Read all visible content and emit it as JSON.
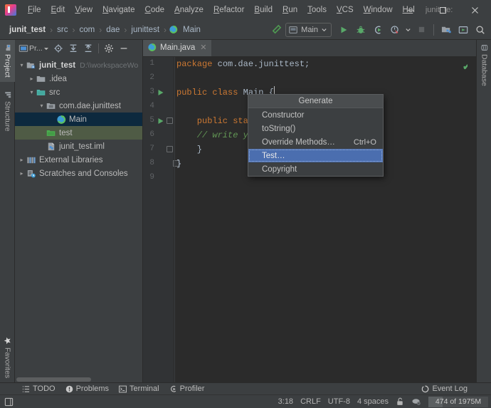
{
  "window": {
    "title": "junit_te:",
    "minimize_label": "─",
    "maximize_label": "☐",
    "close_label": "✕"
  },
  "menu": {
    "items": [
      {
        "mnemonic": "F",
        "rest": "ile"
      },
      {
        "mnemonic": "E",
        "rest": "dit"
      },
      {
        "mnemonic": "V",
        "rest": "iew"
      },
      {
        "mnemonic": "N",
        "rest": "avigate"
      },
      {
        "mnemonic": "C",
        "rest": "ode"
      },
      {
        "mnemonic": "A",
        "rest": "nalyze"
      },
      {
        "mnemonic": "R",
        "rest": "efactor"
      },
      {
        "mnemonic": "B",
        "rest": "uild"
      },
      {
        "mnemonic": "R",
        "rest": "un"
      },
      {
        "mnemonic": "T",
        "rest": "ools"
      },
      {
        "mnemonic": "V",
        "rest": "CS"
      },
      {
        "mnemonic": "W",
        "rest": "indow"
      },
      {
        "mnemonic": "He",
        "rest": "l"
      }
    ]
  },
  "navbar": {
    "breadcrumbs": [
      "junit_test",
      "src",
      "com",
      "dae",
      "junittest",
      "Main"
    ],
    "separator": "›",
    "run_config": "Main",
    "icons": [
      "build-hammer-icon",
      "run-icon",
      "debug-icon",
      "run-coverage-icon",
      "profiler-icon",
      "stop-icon",
      "project-structure-icon",
      "update-project-icon",
      "search-everywhere-icon"
    ]
  },
  "left_strip": {
    "tabs": [
      {
        "label": "Project",
        "icon": "project-icon",
        "active": true
      },
      {
        "label": "Structure",
        "icon": "structure-icon",
        "active": false
      },
      {
        "label": "Favorites",
        "icon": "star-icon",
        "active": false
      }
    ]
  },
  "right_strip": {
    "tabs": [
      {
        "label": "Database",
        "icon": "database-icon",
        "active": false
      }
    ]
  },
  "project_panel": {
    "title": "Pr...",
    "toolbar_icons": [
      "select-opened-file-icon",
      "expand-all-icon",
      "collapse-all-icon",
      "settings-gear-icon",
      "hide-icon"
    ],
    "tree": [
      {
        "label": "junit_test",
        "sub": "D:\\\\workspaceWo",
        "depth": 0,
        "arrow": "▾",
        "icon": "module-icon",
        "bold": true,
        "state": "none"
      },
      {
        "label": ".idea",
        "sub": "",
        "depth": 1,
        "arrow": "▸",
        "icon": "folder-icon",
        "bold": false,
        "state": "none"
      },
      {
        "label": "src",
        "sub": "",
        "depth": 1,
        "arrow": "▾",
        "icon": "source-folder-icon",
        "bold": false,
        "state": "none"
      },
      {
        "label": "com.dae.junittest",
        "sub": "",
        "depth": 2,
        "arrow": "▾",
        "icon": "package-icon",
        "bold": false,
        "state": "none"
      },
      {
        "label": "Main",
        "sub": "",
        "depth": 3,
        "arrow": "",
        "icon": "java-class-icon",
        "bold": false,
        "state": "selected"
      },
      {
        "label": "test",
        "sub": "",
        "depth": 2,
        "arrow": "",
        "icon": "test-folder-icon",
        "bold": false,
        "state": "green"
      },
      {
        "label": "junit_test.iml",
        "sub": "",
        "depth": 2,
        "arrow": "",
        "icon": "iml-file-icon",
        "bold": false,
        "state": "none"
      },
      {
        "label": "External Libraries",
        "sub": "",
        "depth": 0,
        "arrow": "▸",
        "icon": "libraries-icon",
        "bold": false,
        "state": "none"
      },
      {
        "label": "Scratches and Consoles",
        "sub": "",
        "depth": 0,
        "arrow": "▸",
        "icon": "scratches-icon",
        "bold": false,
        "state": "none"
      }
    ]
  },
  "editor": {
    "tab": {
      "label": "Main.java",
      "icon": "java-class-icon",
      "close": "✕"
    },
    "inspection_status": "✔",
    "line_numbers": [
      "1",
      "2",
      "3",
      "4",
      "5",
      "6",
      "7",
      "8",
      "9"
    ],
    "code_lines": [
      {
        "n": 1,
        "tokens": [
          {
            "t": "package",
            "c": "k-key"
          },
          {
            "t": " com.dae.junittest;",
            "c": "k-pln"
          }
        ]
      },
      {
        "n": 2,
        "tokens": []
      },
      {
        "n": 3,
        "tokens": [
          {
            "t": "public class ",
            "c": "k-key"
          },
          {
            "t": "Main",
            "c": "k-cls"
          },
          {
            "t": " {",
            "c": "k-pln"
          }
        ]
      },
      {
        "n": 4,
        "tokens": []
      },
      {
        "n": 5,
        "tokens": [
          {
            "t": "    public static",
            "c": "k-key"
          }
        ]
      },
      {
        "n": 6,
        "tokens": [
          {
            "t": "    // write your",
            "c": "k-cmt"
          }
        ]
      },
      {
        "n": 7,
        "tokens": [
          {
            "t": "    }",
            "c": "k-pln"
          }
        ]
      },
      {
        "n": 8,
        "tokens": [
          {
            "t": "}",
            "c": "k-pln"
          }
        ]
      },
      {
        "n": 9,
        "tokens": []
      }
    ],
    "gutter_run_lines": [
      3,
      5
    ]
  },
  "generate_popup": {
    "header": "Generate",
    "items": [
      {
        "label": "Constructor",
        "shortcut": "",
        "selected": false
      },
      {
        "label": "toString()",
        "shortcut": "",
        "selected": false
      },
      {
        "label": "Override Methods…",
        "shortcut": "Ctrl+O",
        "selected": false
      },
      {
        "label": "Test…",
        "shortcut": "",
        "selected": true
      },
      {
        "label": "Copyright",
        "shortcut": "",
        "selected": false
      }
    ]
  },
  "bottom_bar": {
    "items": [
      {
        "label": "TODO",
        "icon": "todo-icon"
      },
      {
        "label": "Problems",
        "icon": "problems-icon"
      },
      {
        "label": "Terminal",
        "icon": "terminal-icon"
      },
      {
        "label": "Profiler",
        "icon": "profiler-icon"
      }
    ],
    "event_log": {
      "label": "Event Log",
      "icon": "event-log-icon"
    }
  },
  "status_bar": {
    "left_icon": "ide-frame-icon",
    "caret_position": "3:18",
    "line_separator": "CRLF",
    "encoding": "UTF-8",
    "indent": "4 spaces",
    "lock_icon": "unlocked-icon",
    "vcs_icon": "vcs-branch-icon",
    "memory": "474 of 1975M",
    "memory_used_percent": 24
  },
  "colors": {
    "bg_chrome": "#3c3f41",
    "bg_editor": "#2b2b2b",
    "accent_selection": "#4b6eaf",
    "tree_selection": "#0d293e",
    "tree_green": "#4f5b45",
    "keyword": "#cc7832",
    "comment": "#629755",
    "text": "#a9b7c6",
    "run_green": "#59a869"
  }
}
